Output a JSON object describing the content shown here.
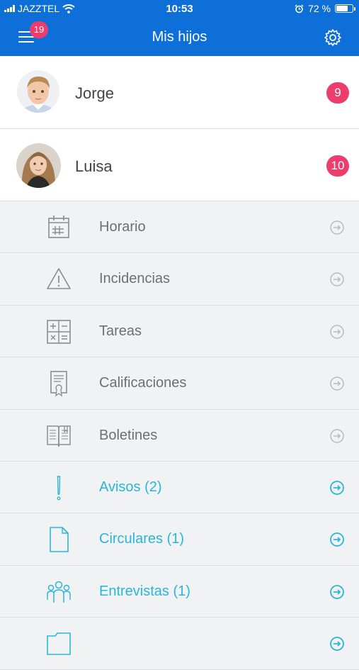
{
  "status_bar": {
    "carrier": "JAZZTEL",
    "time": "10:53",
    "battery_text": "72 %",
    "battery_level": 0.72
  },
  "header": {
    "title": "Mis hijos",
    "menu_badge": "19"
  },
  "children": [
    {
      "name": "Jorge",
      "badge": "9"
    },
    {
      "name": "Luisa",
      "badge": "10"
    }
  ],
  "menu": [
    {
      "label": "Horario",
      "icon": "calendar-icon",
      "active": false
    },
    {
      "label": "Incidencias",
      "icon": "warning-icon",
      "active": false
    },
    {
      "label": "Tareas",
      "icon": "calculator-icon",
      "active": false
    },
    {
      "label": "Calificaciones",
      "icon": "certificate-icon",
      "active": false
    },
    {
      "label": "Boletines",
      "icon": "book-icon",
      "active": false
    },
    {
      "label": "Avisos (2)",
      "icon": "exclamation-icon",
      "active": true
    },
    {
      "label": "Circulares (1)",
      "icon": "document-icon",
      "active": true
    },
    {
      "label": "Entrevistas (1)",
      "icon": "people-icon",
      "active": true
    },
    {
      "label": "",
      "icon": "folder-icon",
      "active": true
    }
  ],
  "colors": {
    "brand": "#0f6fd8",
    "badge": "#ec3d6d",
    "active": "#29b6d9",
    "inactive": "#6d6f72"
  }
}
